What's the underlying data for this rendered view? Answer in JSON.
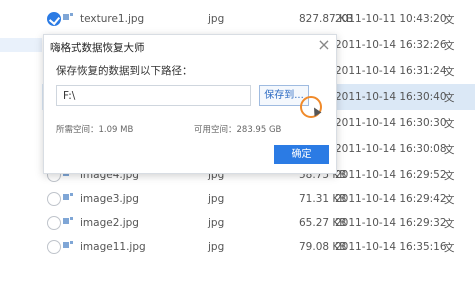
{
  "files": [
    {
      "name": "texture1.jpg",
      "type": "jpg",
      "size": "827.87 KB",
      "date": "2011-10-11 10:43:20",
      "more": "文",
      "checked": true
    },
    {
      "name": "",
      "type": "",
      "size": "",
      "date": "2011-10-14 16:32:26",
      "more": "文",
      "checked": false
    },
    {
      "name": "",
      "type": "",
      "size": "",
      "date": "2011-10-14 16:31:24",
      "more": "文",
      "checked": false
    },
    {
      "name": "",
      "type": "",
      "size": "",
      "date": "2011-10-14 16:30:40",
      "more": "文",
      "checked": false
    },
    {
      "name": "",
      "type": "",
      "size": "",
      "date": "2011-10-14 16:30:30",
      "more": "文",
      "checked": false
    },
    {
      "name": "",
      "type": "",
      "size": "",
      "date": "2011-10-14 16:30:08",
      "more": "文",
      "checked": false
    },
    {
      "name": "image4.jpg",
      "type": "jpg",
      "size": "58.75 KB",
      "date": "2011-10-14 16:29:52",
      "more": "文",
      "checked": false
    },
    {
      "name": "image3.jpg",
      "type": "jpg",
      "size": "71.31 KB",
      "date": "2011-10-14 16:29:42",
      "more": "文",
      "checked": false
    },
    {
      "name": "image2.jpg",
      "type": "jpg",
      "size": "65.27 KB",
      "date": "2011-10-14 16:29:32",
      "more": "文",
      "checked": false
    },
    {
      "name": "image11.jpg",
      "type": "jpg",
      "size": "79.08 KB",
      "date": "2011-10-14 16:35:16",
      "more": "文",
      "checked": false
    }
  ],
  "dialog": {
    "title": "嗨格式数据恢复大师",
    "close_icon": "×",
    "label": "保存恢复的数据到以下路径：",
    "path_value": "F:\\",
    "save_to_label": "保存到...",
    "space_used": "所需空间：1.09 MB",
    "space_free": "可用空间：283.95 GB",
    "confirm_label": "确定"
  },
  "colors": {
    "accent": "#2b7be4",
    "highlight_row": "#dbe8f6",
    "cursor_ring": "#f08a2a"
  }
}
